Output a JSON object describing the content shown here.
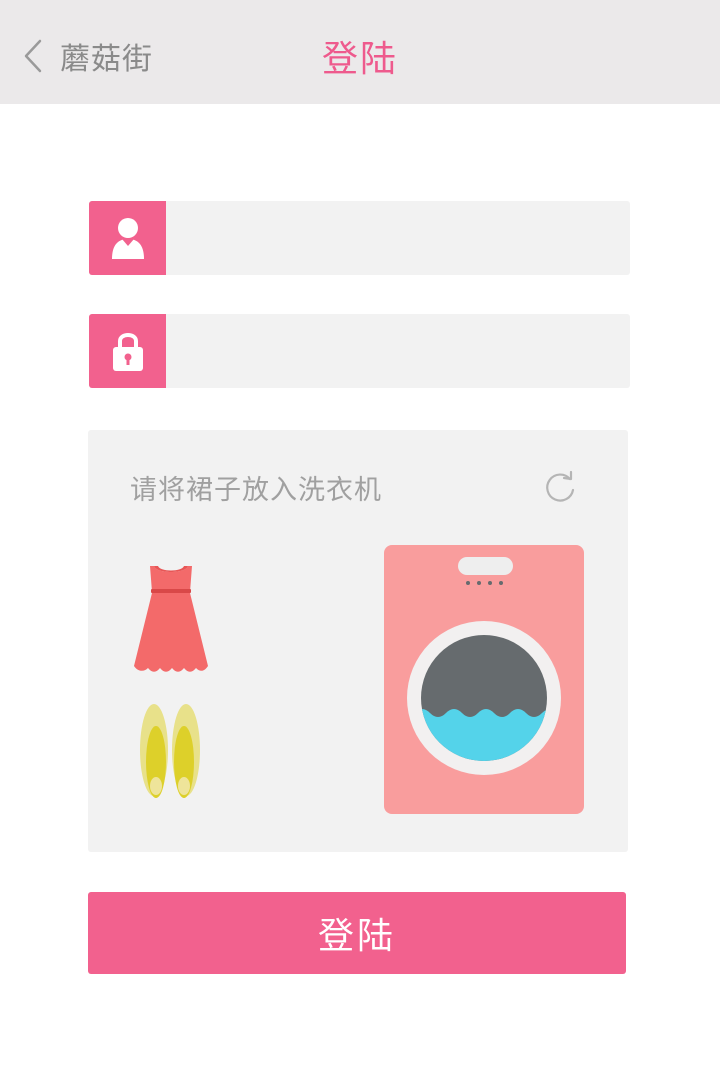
{
  "header": {
    "back_label": "蘑菇街",
    "title": "登陆"
  },
  "form": {
    "username": {
      "icon": "user-icon",
      "value": "",
      "placeholder": ""
    },
    "password": {
      "icon": "lock-icon",
      "value": "",
      "placeholder": ""
    }
  },
  "captcha": {
    "prompt": "请将裙子放入洗衣机",
    "refresh_icon": "refresh-icon",
    "items": [
      "dress-icon",
      "shoes-icon"
    ],
    "target": "washing-machine-icon"
  },
  "submit": {
    "label": "登陆"
  },
  "colors": {
    "accent": "#f2618e",
    "header_bg": "#ebe9ea",
    "field_bg": "#f2f2f2",
    "dress": "#f36a6a",
    "shoes": "#ddd02a",
    "washer": "#f99d9d",
    "water": "#54d3ea"
  }
}
